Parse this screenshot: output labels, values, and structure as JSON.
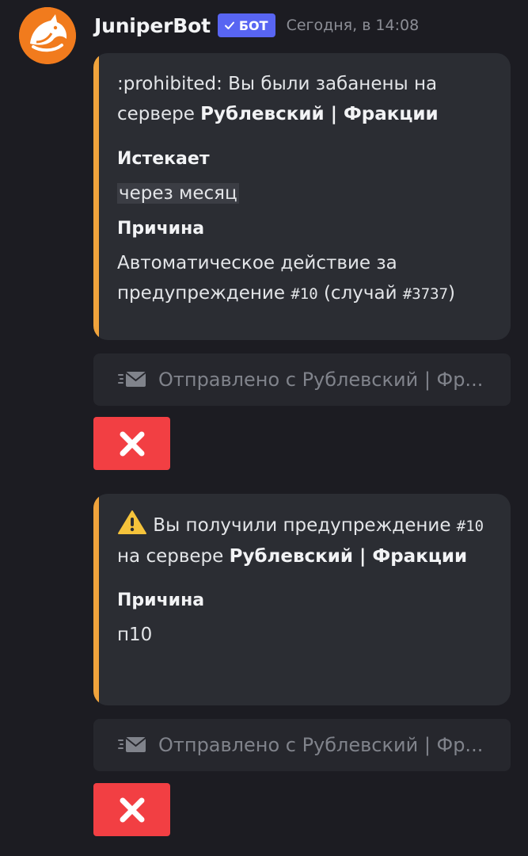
{
  "message": {
    "author": "JuniperBot",
    "bot_badge": "БОТ",
    "timestamp": "Сегодня, в 14:08",
    "avatar_icon": "fox-icon"
  },
  "embeds": [
    {
      "accent": "#f0a33c",
      "desc_prefix": ":prohibited: Вы были забанены на сервере ",
      "desc_server": "Рублевский | Фракции",
      "fields": [
        {
          "name": "Истекает",
          "value": "через месяц"
        },
        {
          "name": "Причина",
          "value_pre": "Автоматическое действие за предупреждение ",
          "value_code1": "#10",
          "value_mid": " (случай ",
          "value_code2": "#3737",
          "value_post": ")"
        }
      ]
    },
    {
      "accent": "#f0a33c",
      "icon": "warning-icon",
      "desc_text": " Вы получили предупреждение ",
      "desc_code": "#10",
      "desc_mid": " на сервере ",
      "desc_server": "Рублевский | Фракции",
      "fields": [
        {
          "name": "Причина",
          "value": "п10"
        }
      ]
    }
  ],
  "sent_from": [
    {
      "icon": "envelope-icon",
      "text": "Отправлено с Рублевский | Фр..."
    },
    {
      "icon": "envelope-icon",
      "text": "Отправлено с Рублевский | Фр..."
    }
  ],
  "buttons": [
    {
      "icon": "close-icon",
      "color": "#f23f43"
    },
    {
      "icon": "close-icon",
      "color": "#f23f43"
    }
  ]
}
